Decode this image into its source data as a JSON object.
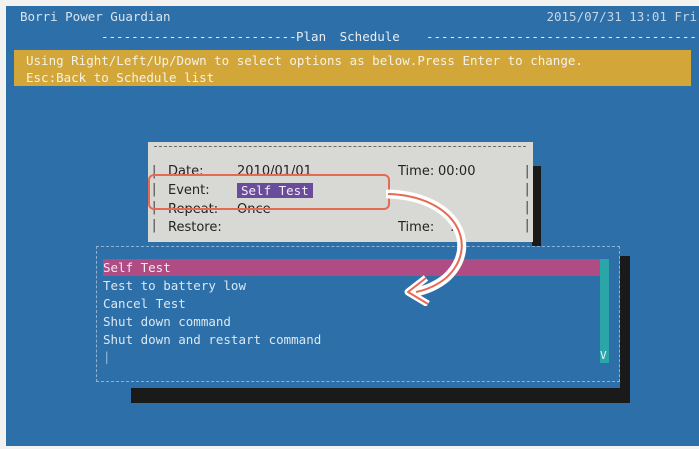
{
  "app": {
    "title": "Borri Power Guardian",
    "datetime": "2015/07/31 13:01 Fri"
  },
  "header": {
    "dashes_left": "--------------------------",
    "subtitle": "Plan Schedule",
    "dashes_right": "-------------------------------------"
  },
  "instructions": {
    "line1": "Using Right/Left/Up/Down to select options as below.Press Enter to change.",
    "line2": "Esc:Back to Schedule list"
  },
  "dialog": {
    "date_label": "Date:",
    "date_value": "2010/01/01",
    "time_label": "Time:",
    "time_value": "00:00",
    "event_label": "Event:",
    "event_value": "Self Test",
    "repeat_label": "Repeat:",
    "repeat_value": "Once",
    "restore_label": "Restore:",
    "restore_time_label": "Time:",
    "restore_time_value": ":"
  },
  "event_options": [
    "Self Test",
    "Test to battery low",
    "Cancel Test",
    "Shut down command",
    "Shut down and restart command"
  ],
  "scroll_arrow": "V",
  "colors": {
    "background": "#2d6fa9",
    "instruction_bar": "#d3a63a",
    "selected_row": "#b04c84",
    "annotation": "#e56a53"
  }
}
